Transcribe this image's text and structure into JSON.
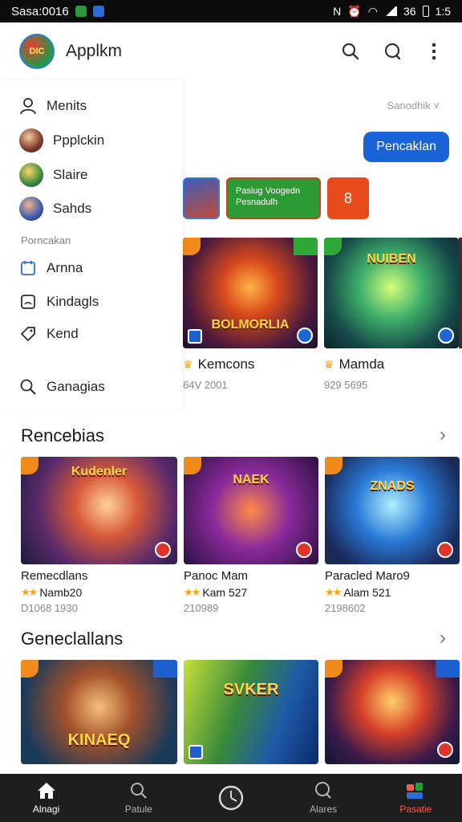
{
  "status_bar": {
    "time_left": "Sasa:0016",
    "time_right": "1:5",
    "battery_label": "36"
  },
  "app": {
    "title": "Applkm",
    "logo_text": "DIC"
  },
  "drawer": {
    "items": [
      {
        "label": "Menits",
        "icon": "person-icon"
      },
      {
        "label": "Ppplckin",
        "icon": "avatar"
      },
      {
        "label": "Slaire",
        "icon": "avatar"
      },
      {
        "label": "Sahds",
        "icon": "avatar"
      }
    ],
    "section_label": "Porncakan",
    "links": [
      {
        "label": "Arnna",
        "icon": "calendar-icon"
      },
      {
        "label": "Kindagls",
        "icon": "frame-icon"
      },
      {
        "label": "Kend",
        "icon": "tag-icon"
      }
    ],
    "search_label": "Ganagias"
  },
  "main": {
    "filter_label": "Sanodhik",
    "primary_button": "Pencaklan",
    "chip_green_text": "Pasiug Voogedn Pesnadulh",
    "chip_red_text": "8",
    "featured": [
      {
        "art_title": "BOLMORLIA",
        "name": "Kemcons",
        "meta": "64V 2001"
      },
      {
        "art_title": "NUIBEN",
        "name": "Mamda",
        "meta": "929 5695"
      }
    ]
  },
  "sections": [
    {
      "title": "Rencebias",
      "cards": [
        {
          "art_title": "Kudenler",
          "name": "Remecdlans",
          "rating_text": "Namb20",
          "meta": "D1068 1930"
        },
        {
          "art_title": "NAEK",
          "name": "Panoc Mam",
          "rating_text": "Kam 527",
          "meta": "210989"
        },
        {
          "art_title": "ZNADS",
          "name": "Paracled Maro9",
          "rating_text": "Alam 521",
          "meta": "2198602"
        }
      ]
    },
    {
      "title": "Geneclallans",
      "cards": [
        {
          "art_title": "KINAEQ"
        },
        {
          "art_title": "SVKER"
        },
        {
          "art_title": ""
        }
      ]
    }
  ],
  "bottom_nav": [
    {
      "label": "Alnagi",
      "icon": "home-icon"
    },
    {
      "label": "Patule",
      "icon": "search-icon"
    },
    {
      "label": "",
      "icon": "clock-icon"
    },
    {
      "label": "Alares",
      "icon": "chat-icon"
    },
    {
      "label": "Pasatie",
      "icon": "games-icon"
    }
  ],
  "colors": {
    "accent": "#1a63d8",
    "active_nav": "#ff5a4a",
    "star": "#f2a414"
  }
}
